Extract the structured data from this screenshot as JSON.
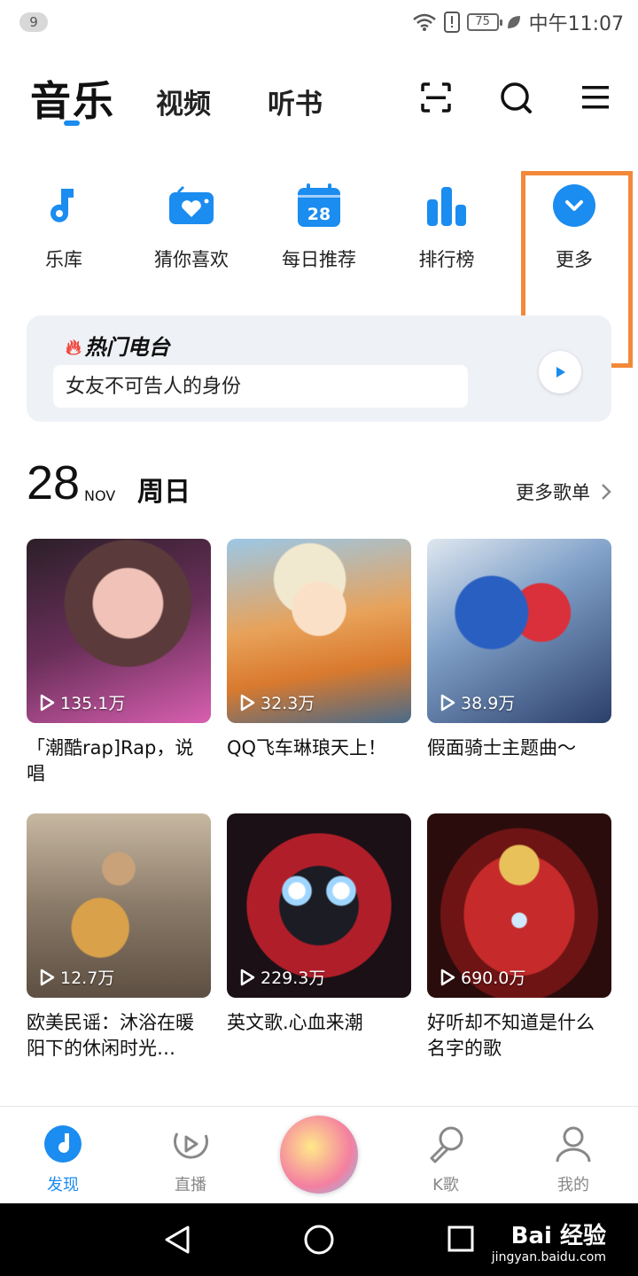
{
  "status_bar": {
    "notification_count": "9",
    "battery": "75",
    "time": "中午11:07"
  },
  "top_nav": {
    "tabs": [
      "音乐",
      "视频",
      "听书"
    ],
    "active_tab": "音乐",
    "accent_color": "#1b8cf0"
  },
  "quick_entries": [
    {
      "label": "乐库",
      "icon": "music-note-icon"
    },
    {
      "label": "猜你喜欢",
      "icon": "radio-heart-icon"
    },
    {
      "label": "每日推荐",
      "icon": "calendar-icon",
      "badge": "28"
    },
    {
      "label": "排行榜",
      "icon": "bar-chart-icon"
    },
    {
      "label": "更多",
      "icon": "chevron-down-circle-icon"
    }
  ],
  "hot_radio": {
    "title": "热门电台",
    "item": "女友不可告人的身份"
  },
  "daily": {
    "day": "28",
    "month": "NOV",
    "weekday": "周日",
    "more_label": "更多歌单"
  },
  "playlists": [
    {
      "plays": "135.1万",
      "title": "「潮酷rap]Rap，说唱"
    },
    {
      "plays": "32.3万",
      "title": "QQ飞车琳琅天上！"
    },
    {
      "plays": "38.9万",
      "title": "假面骑士主题曲～"
    },
    {
      "plays": "12.7万",
      "title": "欧美民谣：沐浴在暖阳下的休闲时光…"
    },
    {
      "plays": "229.3万",
      "title": "英文歌.心血来潮"
    },
    {
      "plays": "690.0万",
      "title": "好听却不知道是什么名字的歌"
    }
  ],
  "bottom_nav": [
    {
      "label": "发现",
      "active": true
    },
    {
      "label": "直播"
    },
    {
      "label": "K歌"
    },
    {
      "label": "我的"
    }
  ],
  "watermark": {
    "main": "Bai 经验",
    "sub": "jingyan.baidu.com"
  }
}
